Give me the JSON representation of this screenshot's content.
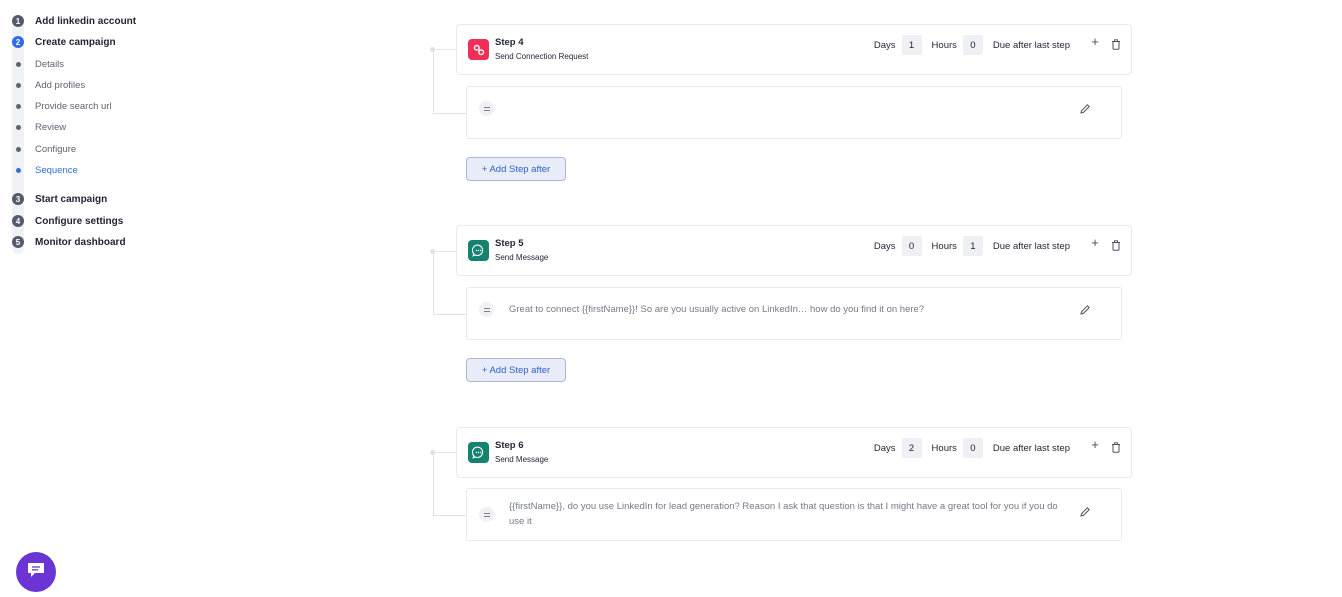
{
  "sidebar": {
    "steps": [
      {
        "num": "1",
        "label": "Add linkedin account"
      },
      {
        "num": "2",
        "label": "Create campaign"
      },
      {
        "num": "3",
        "label": "Start campaign"
      },
      {
        "num": "4",
        "label": "Configure settings"
      },
      {
        "num": "5",
        "label": "Monitor dashboard"
      }
    ],
    "substeps": [
      {
        "label": "Details"
      },
      {
        "label": "Add profiles"
      },
      {
        "label": "Provide search url"
      },
      {
        "label": "Review"
      },
      {
        "label": "Configure"
      },
      {
        "label": "Sequence"
      }
    ],
    "active_step": "2",
    "active_substep": "Sequence"
  },
  "sequence": [
    {
      "title": "Step 4",
      "action": "Send Connection Request",
      "icon": "link-icon",
      "icon_color": "#ef2f55",
      "days_label": "Days",
      "days": "1",
      "hours_label": "Hours",
      "hours": "0",
      "due_label": "Due after last step",
      "message": "",
      "add_label": "+ Add Step after"
    },
    {
      "title": "Step 5",
      "action": "Send Message",
      "icon": "chat-bubble-icon",
      "icon_color": "#14826e",
      "days_label": "Days",
      "days": "0",
      "hours_label": "Hours",
      "hours": "1",
      "due_label": "Due after last step",
      "message": "Great to connect {{firstName}}! So are you usually active on LinkedIn… how do you find it on here?",
      "add_label": "+ Add Step after"
    },
    {
      "title": "Step 6",
      "action": "Send Message",
      "icon": "chat-bubble-icon",
      "icon_color": "#14826e",
      "days_label": "Days",
      "days": "2",
      "hours_label": "Hours",
      "hours": "0",
      "due_label": "Due after last step",
      "message": "{{firstName}}, do you use LinkedIn for lead generation? Reason I ask that question is that I might have a great tool for you if you do use it"
    }
  ],
  "colors": {
    "accent": "#2f6ce5",
    "chat_widget": "#6b35d6"
  }
}
